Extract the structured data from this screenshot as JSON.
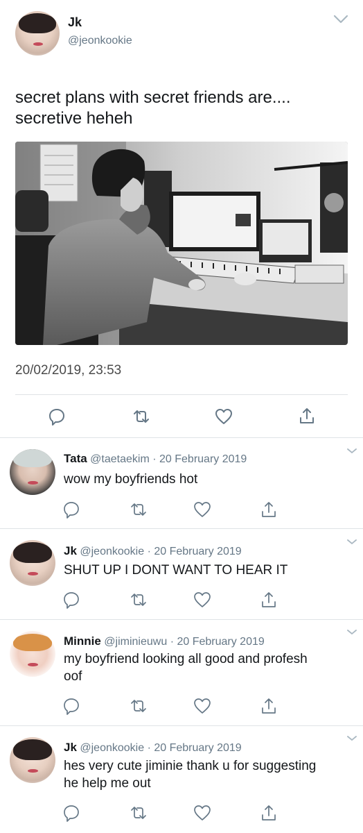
{
  "tweet": {
    "name": "Jk",
    "handle": "@jeonkookie",
    "text_line1": "secret plans with secret friends are....",
    "text_line2": "secretive heheh",
    "timestamp": "20/02/2019, 23:53"
  },
  "replies": [
    {
      "name": "Tata",
      "handle": "@taetaekim",
      "date": "20 February 2019",
      "line1": "wow my boyfriends hot",
      "line2": ""
    },
    {
      "name": "Jk",
      "handle": "@jeonkookie",
      "date": "20 February 2019",
      "line1": "SHUT UP I DONT WANT TO HEAR IT",
      "line2": ""
    },
    {
      "name": "Minnie",
      "handle": "@jiminieuwu",
      "date": "20 February 2019",
      "line1": "my boyfriend looking all good and profesh",
      "line2": "oof"
    },
    {
      "name": "Jk",
      "handle": "@jeonkookie",
      "date": "20 February 2019",
      "line1": "hes very cute jiminie thank u for suggesting",
      "line2": "he help me out"
    }
  ],
  "meta_separator": "·",
  "icons": [
    "reply-icon",
    "retweet-icon",
    "like-icon",
    "share-icon",
    "chevron-down-icon"
  ],
  "colors": {
    "text": "#14171a",
    "secondary": "#657786",
    "divider": "#dfe3e6"
  }
}
